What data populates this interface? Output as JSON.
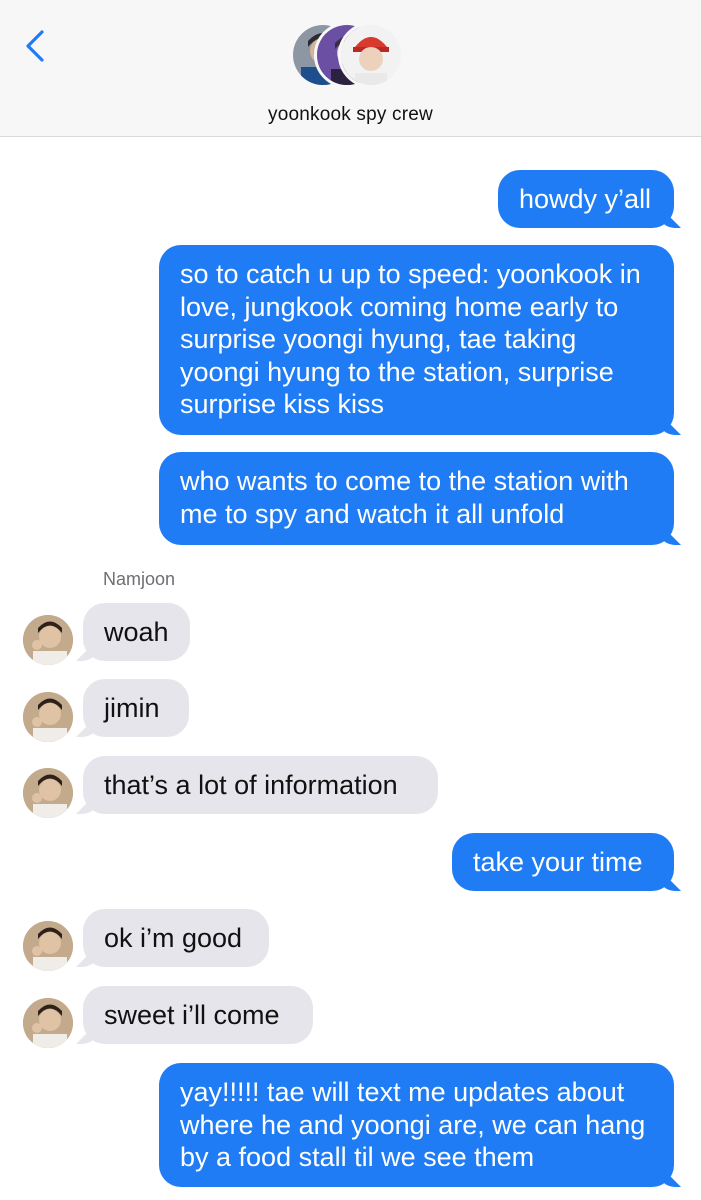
{
  "header": {
    "back_icon": "chevron-left-icon",
    "title": "yoonkook spy crew",
    "accent_color": "#1f7cf4"
  },
  "messages": [
    {
      "from": "me",
      "text": "howdy y’all"
    },
    {
      "from": "me",
      "lines": [
        "so to catch u up to speed: yoonkook in",
        "love, jungkook coming home early to",
        "surprise yoongi hyung, tae taking",
        "yoongi hyung to the station, surprise",
        "surprise kiss kiss"
      ]
    },
    {
      "from": "me",
      "lines": [
        "who wants to come to the station with",
        "me to spy and watch it all unfold"
      ]
    },
    {
      "from": "Namjoon",
      "text": "woah"
    },
    {
      "from": "Namjoon",
      "text": "jimin"
    },
    {
      "from": "Namjoon",
      "text": "that’s a lot of information"
    },
    {
      "from": "me",
      "text": "take your time"
    },
    {
      "from": "Namjoon",
      "text": "ok i’m good"
    },
    {
      "from": "Namjoon",
      "text": "sweet i’ll come"
    },
    {
      "from": "me",
      "lines": [
        "yay!!!!! tae will text me updates about",
        "where he and yoongi are, we can hang",
        "by a food stall til we see them"
      ]
    }
  ],
  "sender_label": "Namjoon",
  "colors": {
    "outgoing": "#1f7cf4",
    "incoming": "#e6e5eb"
  }
}
